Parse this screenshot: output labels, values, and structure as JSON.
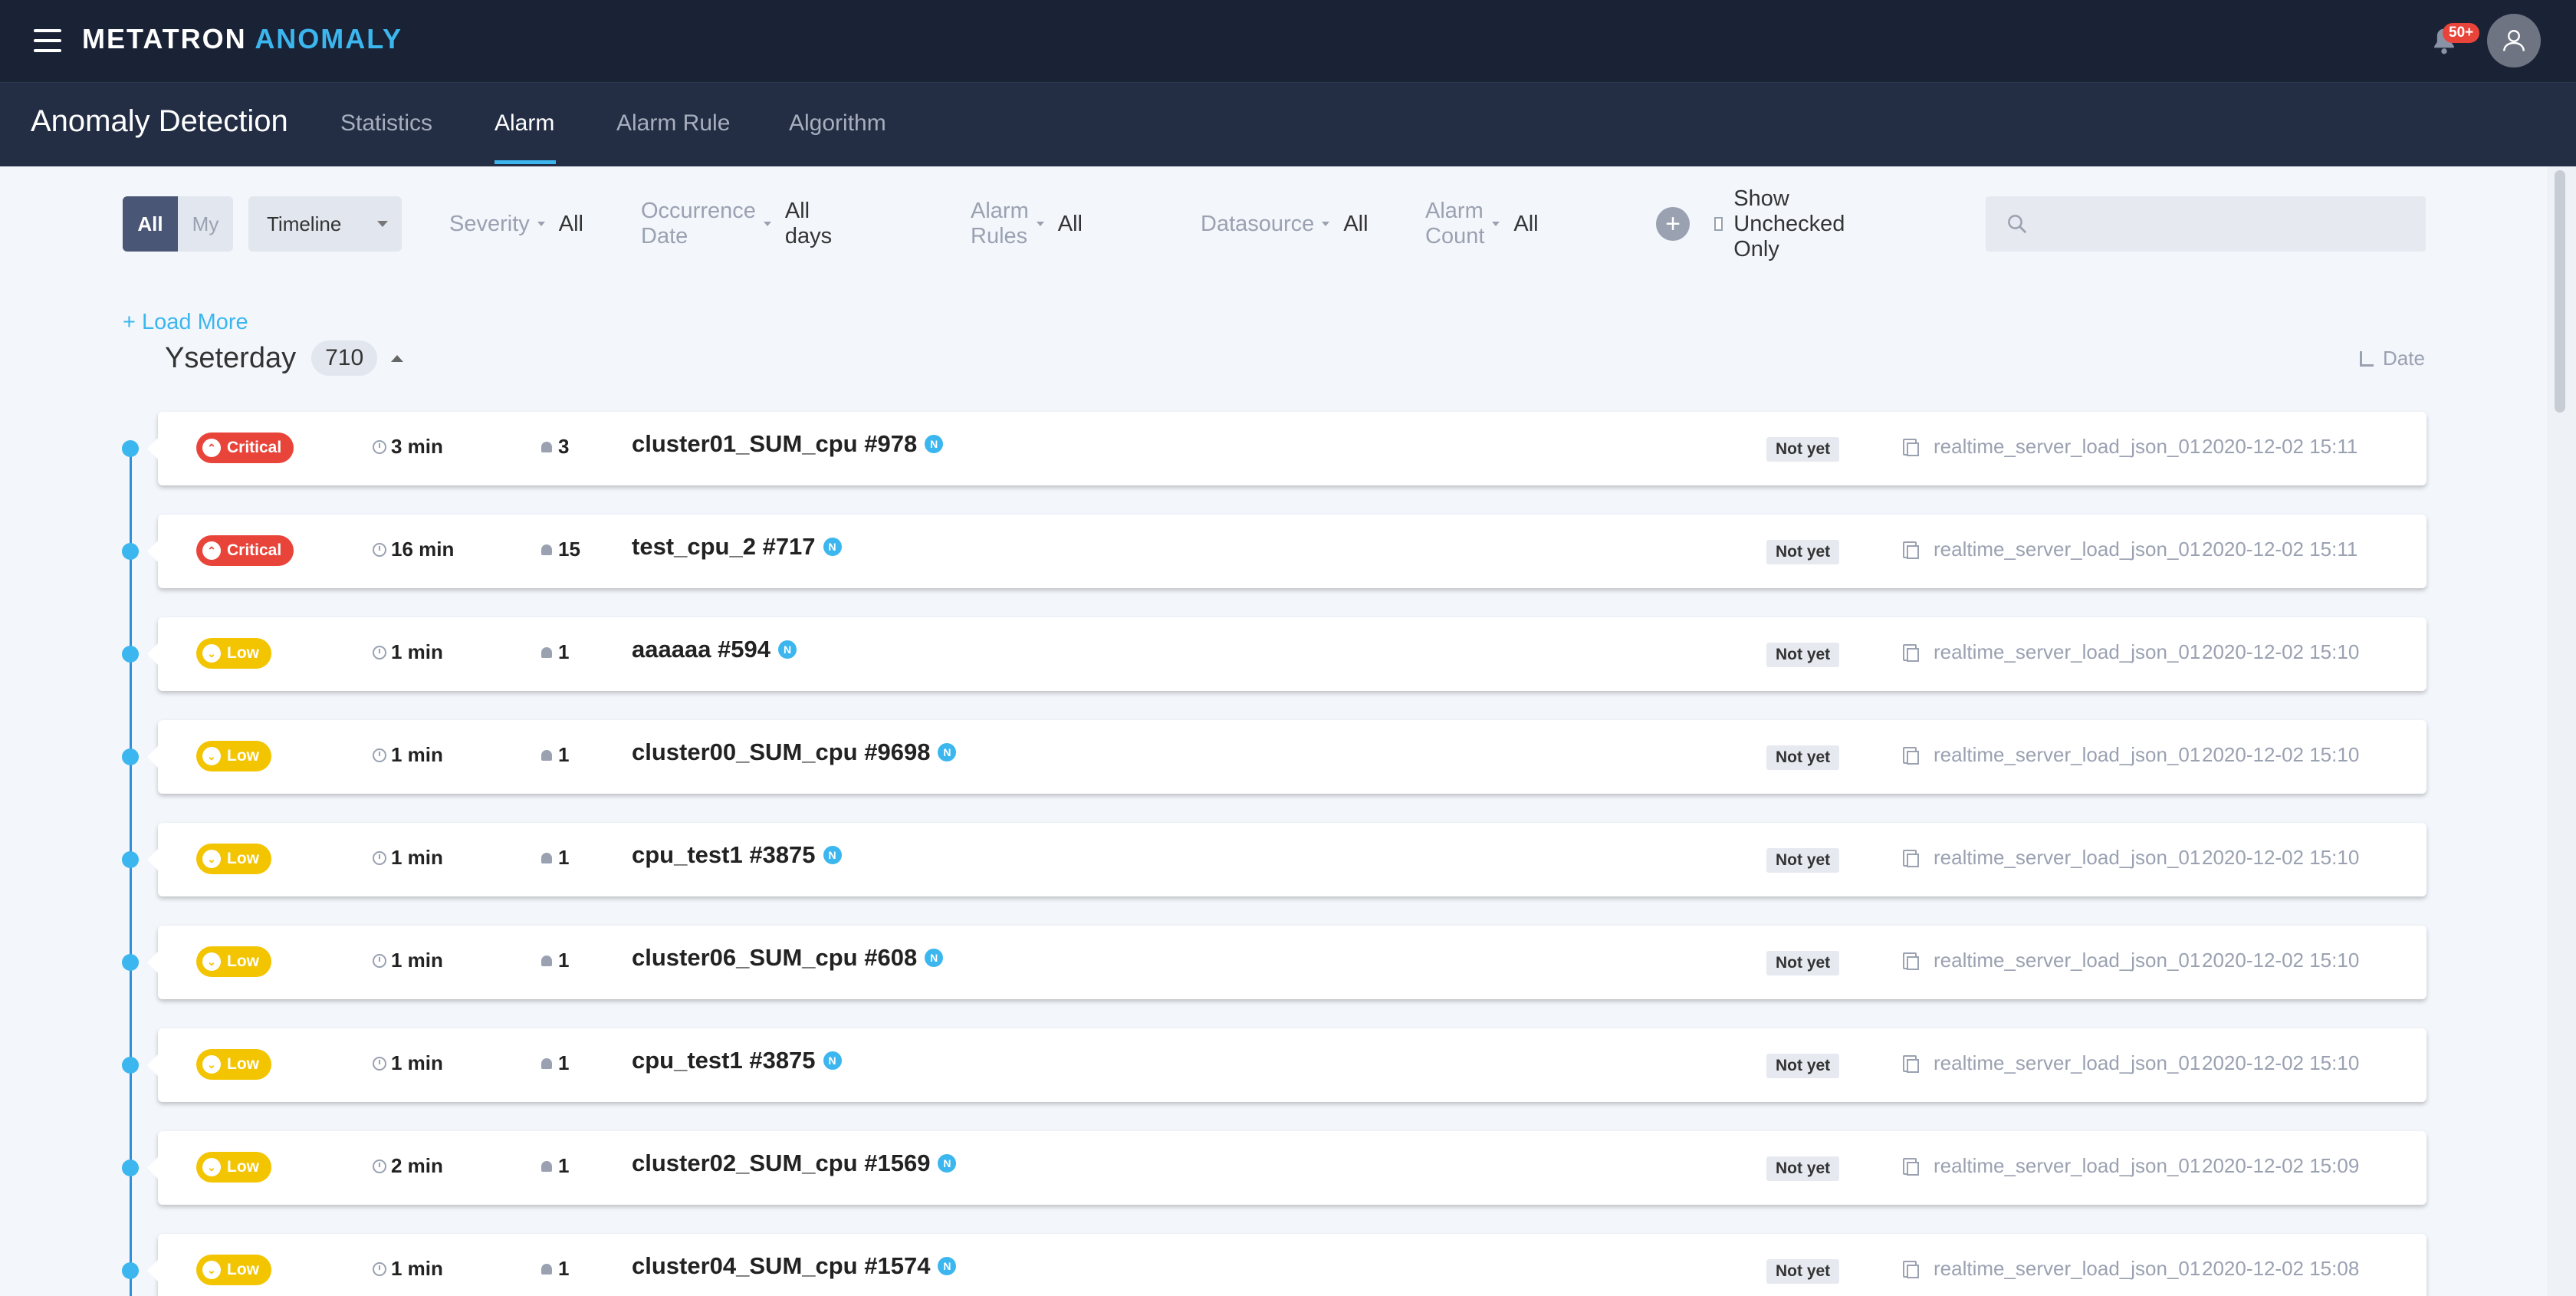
{
  "header": {
    "brand_part1": "METATRON",
    "brand_part2": "ANOMALY",
    "notification_badge": "50+"
  },
  "subnav": {
    "title": "Anomaly Detection",
    "tabs": [
      {
        "label": "Statistics",
        "active": false
      },
      {
        "label": "Alarm",
        "active": true
      },
      {
        "label": "Alarm Rule",
        "active": false
      },
      {
        "label": "Algorithm",
        "active": false
      }
    ]
  },
  "filters": {
    "scope_all": "All",
    "scope_my": "My",
    "view_mode": "Timeline",
    "severity_label": "Severity",
    "severity_value": "All",
    "date_label": "Occurrence Date",
    "date_value": "All days",
    "rules_label": "Alarm Rules",
    "rules_value": "All",
    "datasource_label": "Datasource",
    "datasource_value": "All",
    "count_label": "Alarm Count",
    "count_value": "All",
    "add_filter": "+",
    "unchecked_only": "Show Unchecked Only",
    "search_placeholder": ""
  },
  "list": {
    "load_more": "+ Load More",
    "group_title": "Yseterday",
    "group_count": "710",
    "sort_label": "Date",
    "alarms": [
      {
        "severity": "Critical",
        "sev_class": "critical",
        "duration": "3 min",
        "count": "3",
        "name": "cluster01_SUM_cpu #978",
        "badge": "N",
        "status": "Not yet",
        "datasource": "realtime_server_load_json_01",
        "datetime": "2020-12-02 15:11"
      },
      {
        "severity": "Critical",
        "sev_class": "critical",
        "duration": "16 min",
        "count": "15",
        "name": "test_cpu_2 #717",
        "badge": "N",
        "status": "Not yet",
        "datasource": "realtime_server_load_json_01",
        "datetime": "2020-12-02 15:11"
      },
      {
        "severity": "Low",
        "sev_class": "low",
        "duration": "1 min",
        "count": "1",
        "name": "aaaaaa #594",
        "badge": "N",
        "status": "Not yet",
        "datasource": "realtime_server_load_json_01",
        "datetime": "2020-12-02 15:10"
      },
      {
        "severity": "Low",
        "sev_class": "low",
        "duration": "1 min",
        "count": "1",
        "name": "cluster00_SUM_cpu #9698",
        "badge": "N",
        "status": "Not yet",
        "datasource": "realtime_server_load_json_01",
        "datetime": "2020-12-02 15:10"
      },
      {
        "severity": "Low",
        "sev_class": "low",
        "duration": "1 min",
        "count": "1",
        "name": "cpu_test1 #3875",
        "badge": "N",
        "status": "Not yet",
        "datasource": "realtime_server_load_json_01",
        "datetime": "2020-12-02 15:10"
      },
      {
        "severity": "Low",
        "sev_class": "low",
        "duration": "1 min",
        "count": "1",
        "name": "cluster06_SUM_cpu #608",
        "badge": "N",
        "status": "Not yet",
        "datasource": "realtime_server_load_json_01",
        "datetime": "2020-12-02 15:10"
      },
      {
        "severity": "Low",
        "sev_class": "low",
        "duration": "1 min",
        "count": "1",
        "name": "cpu_test1 #3875",
        "badge": "N",
        "status": "Not yet",
        "datasource": "realtime_server_load_json_01",
        "datetime": "2020-12-02 15:10"
      },
      {
        "severity": "Low",
        "sev_class": "low",
        "duration": "2 min",
        "count": "1",
        "name": "cluster02_SUM_cpu #1569",
        "badge": "N",
        "status": "Not yet",
        "datasource": "realtime_server_load_json_01",
        "datetime": "2020-12-02 15:09"
      },
      {
        "severity": "Low",
        "sev_class": "low",
        "duration": "1 min",
        "count": "1",
        "name": "cluster04_SUM_cpu #1574",
        "badge": "N",
        "status": "Not yet",
        "datasource": "realtime_server_load_json_01",
        "datetime": "2020-12-02 15:08"
      }
    ]
  }
}
